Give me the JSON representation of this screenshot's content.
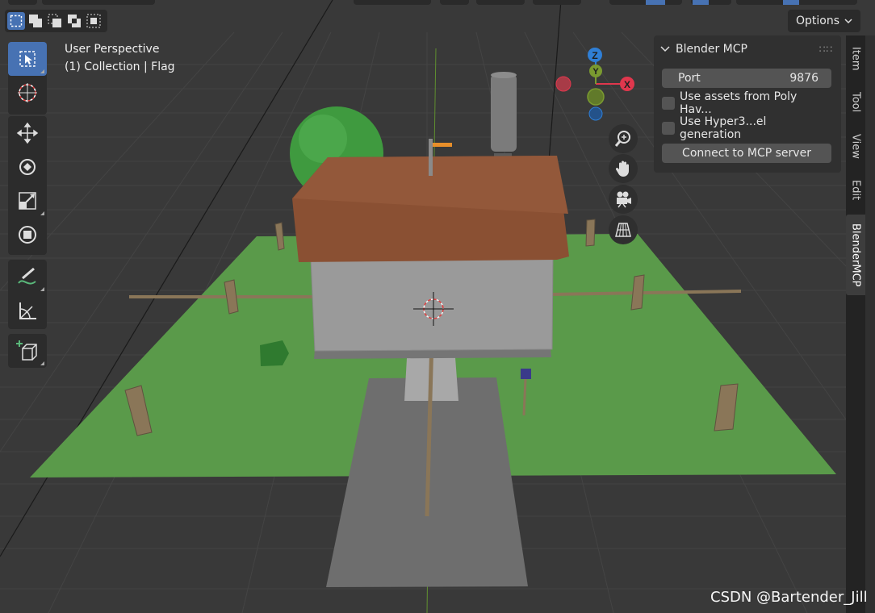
{
  "viewport": {
    "view_name": "User Perspective",
    "collection_info": "(1) Collection | Flag"
  },
  "header": {
    "options_label": "Options",
    "select_modes": [
      "select-box",
      "select-extend",
      "select-subtract",
      "select-difference",
      "select-intersect"
    ]
  },
  "toolbar": {
    "tools": [
      "select-box",
      "cursor",
      "move",
      "rotate",
      "scale",
      "transform",
      "annotate",
      "measure",
      "add-cube"
    ],
    "active_tool": "select-box"
  },
  "gizmo": {
    "axes": [
      "Z",
      "Y",
      "X"
    ],
    "colors": {
      "x": "#e0374d",
      "y": "#7a9a30",
      "z": "#2f7fd6"
    }
  },
  "nav_buttons": [
    "zoom-icon",
    "hand-pan-icon",
    "camera-icon",
    "grid-perspective-icon"
  ],
  "npanel": {
    "title": "Blender MCP",
    "port_label": "Port",
    "port_value": "9876",
    "checkbox_poly_haven": "Use assets from Poly Hav...",
    "checkbox_hyper3d": "Use Hyper3...el generation",
    "poly_haven_checked": false,
    "hyper3d_checked": false,
    "connect_label": "Connect to MCP server"
  },
  "sidebar_tabs": [
    "Item",
    "Tool",
    "View",
    "Edit",
    "BlenderMCP"
  ],
  "active_tab": "BlenderMCP",
  "watermark": "CSDN @Bartender_Jill",
  "scene_colors": {
    "grass": "#5a9a4a",
    "roof": "#8a5033",
    "walls": "#8f8f8f",
    "path": "#6e6e6e",
    "post": "#8a7658",
    "sphere": "#3f9a3f"
  }
}
